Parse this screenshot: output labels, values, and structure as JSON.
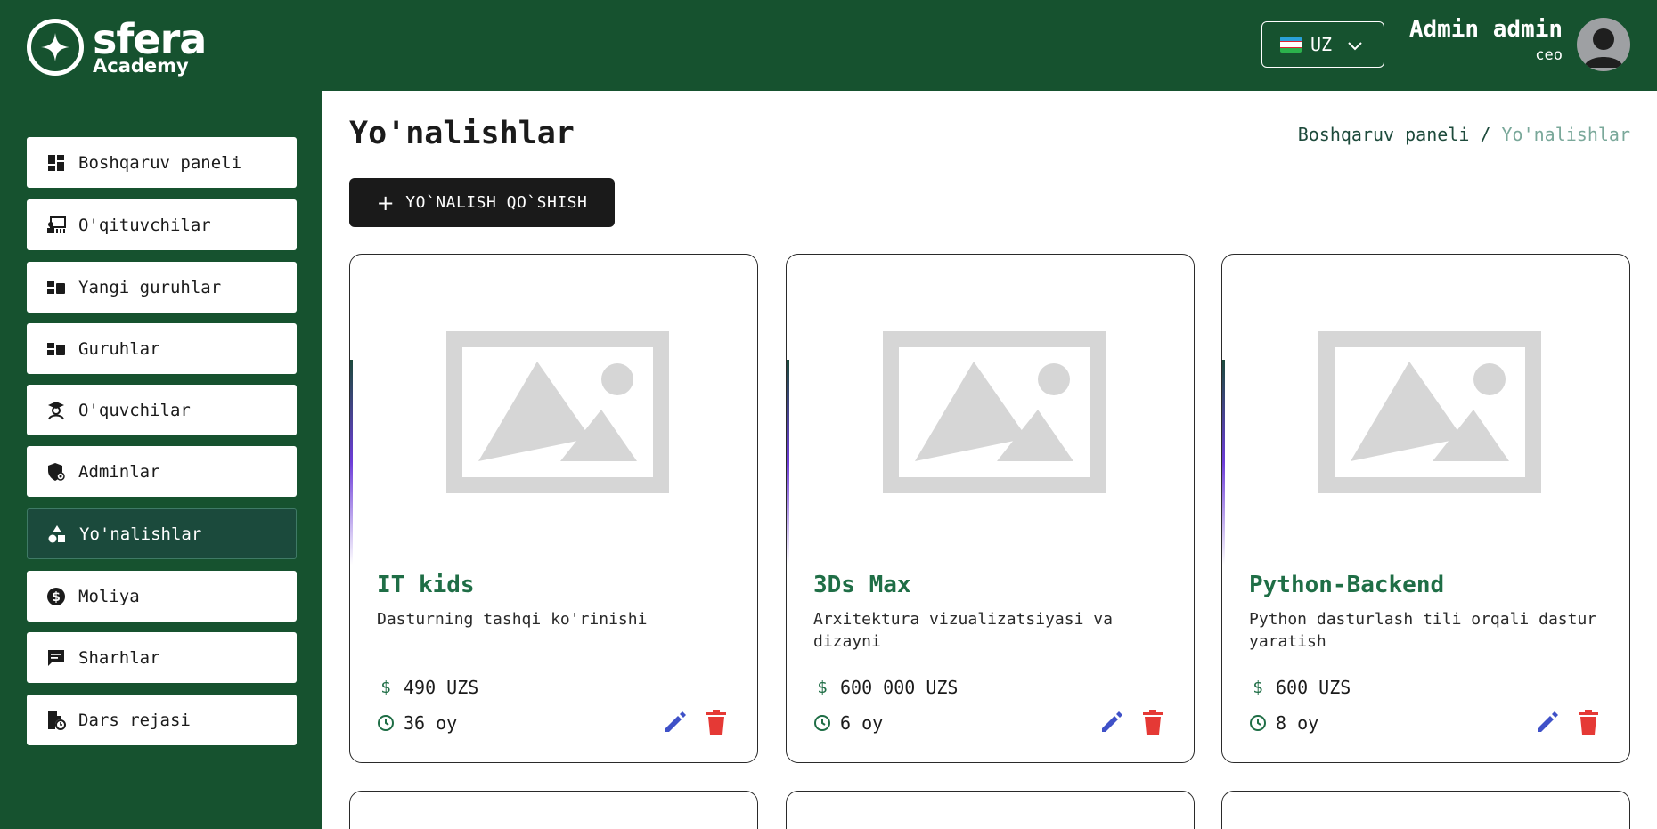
{
  "header": {
    "logo_word": "sfera",
    "logo_sub": "Academy",
    "language": "UZ",
    "user_name": "Admin admin",
    "user_role": "ceo",
    "background_color": "#16522f"
  },
  "sidebar": {
    "items": [
      {
        "label": "Boshqaruv paneli",
        "icon": "dashboard-icon",
        "active": false
      },
      {
        "label": "O'qituvchilar",
        "icon": "teacher-icon",
        "active": false
      },
      {
        "label": "Yangi guruhlar",
        "icon": "new-groups-icon",
        "active": false
      },
      {
        "label": "Guruhlar",
        "icon": "groups-icon",
        "active": false
      },
      {
        "label": "O'quvchilar",
        "icon": "student-icon",
        "active": false
      },
      {
        "label": "Adminlar",
        "icon": "admin-shield-icon",
        "active": false
      },
      {
        "label": "Yo'nalishlar",
        "icon": "categories-icon",
        "active": true
      },
      {
        "label": "Moliya",
        "icon": "finance-icon",
        "active": false
      },
      {
        "label": "Sharhlar",
        "icon": "comment-icon",
        "active": false
      },
      {
        "label": "Dars rejasi",
        "icon": "lesson-plan-icon",
        "active": false
      }
    ]
  },
  "main": {
    "title": "Yo'nalishlar",
    "breadcrumb": {
      "home": "Boshqaruv paneli",
      "separator": "/",
      "current": "Yo'nalishlar"
    },
    "add_button_label": "YO`NALISH QO`SHISH",
    "cards": [
      {
        "title": "IT kids",
        "description": "Dasturning tashqi ko'rinishi",
        "price": "490 UZS",
        "duration": "36 oy"
      },
      {
        "title": "3Ds Max",
        "description": "Arxitektura vizualizatsiyasi va dizayni",
        "price": "600 000 UZS",
        "duration": "6 oy"
      },
      {
        "title": "Python-Backend",
        "description": "Python dasturlash tili orqali dastur yaratish",
        "price": "600 UZS",
        "duration": "8 oy"
      }
    ]
  },
  "colors": {
    "brand_green": "#16522f",
    "active_item": "#1b4a3c",
    "card_title": "#1f6e46",
    "edit": "#3f51c8",
    "delete": "#e53935"
  }
}
